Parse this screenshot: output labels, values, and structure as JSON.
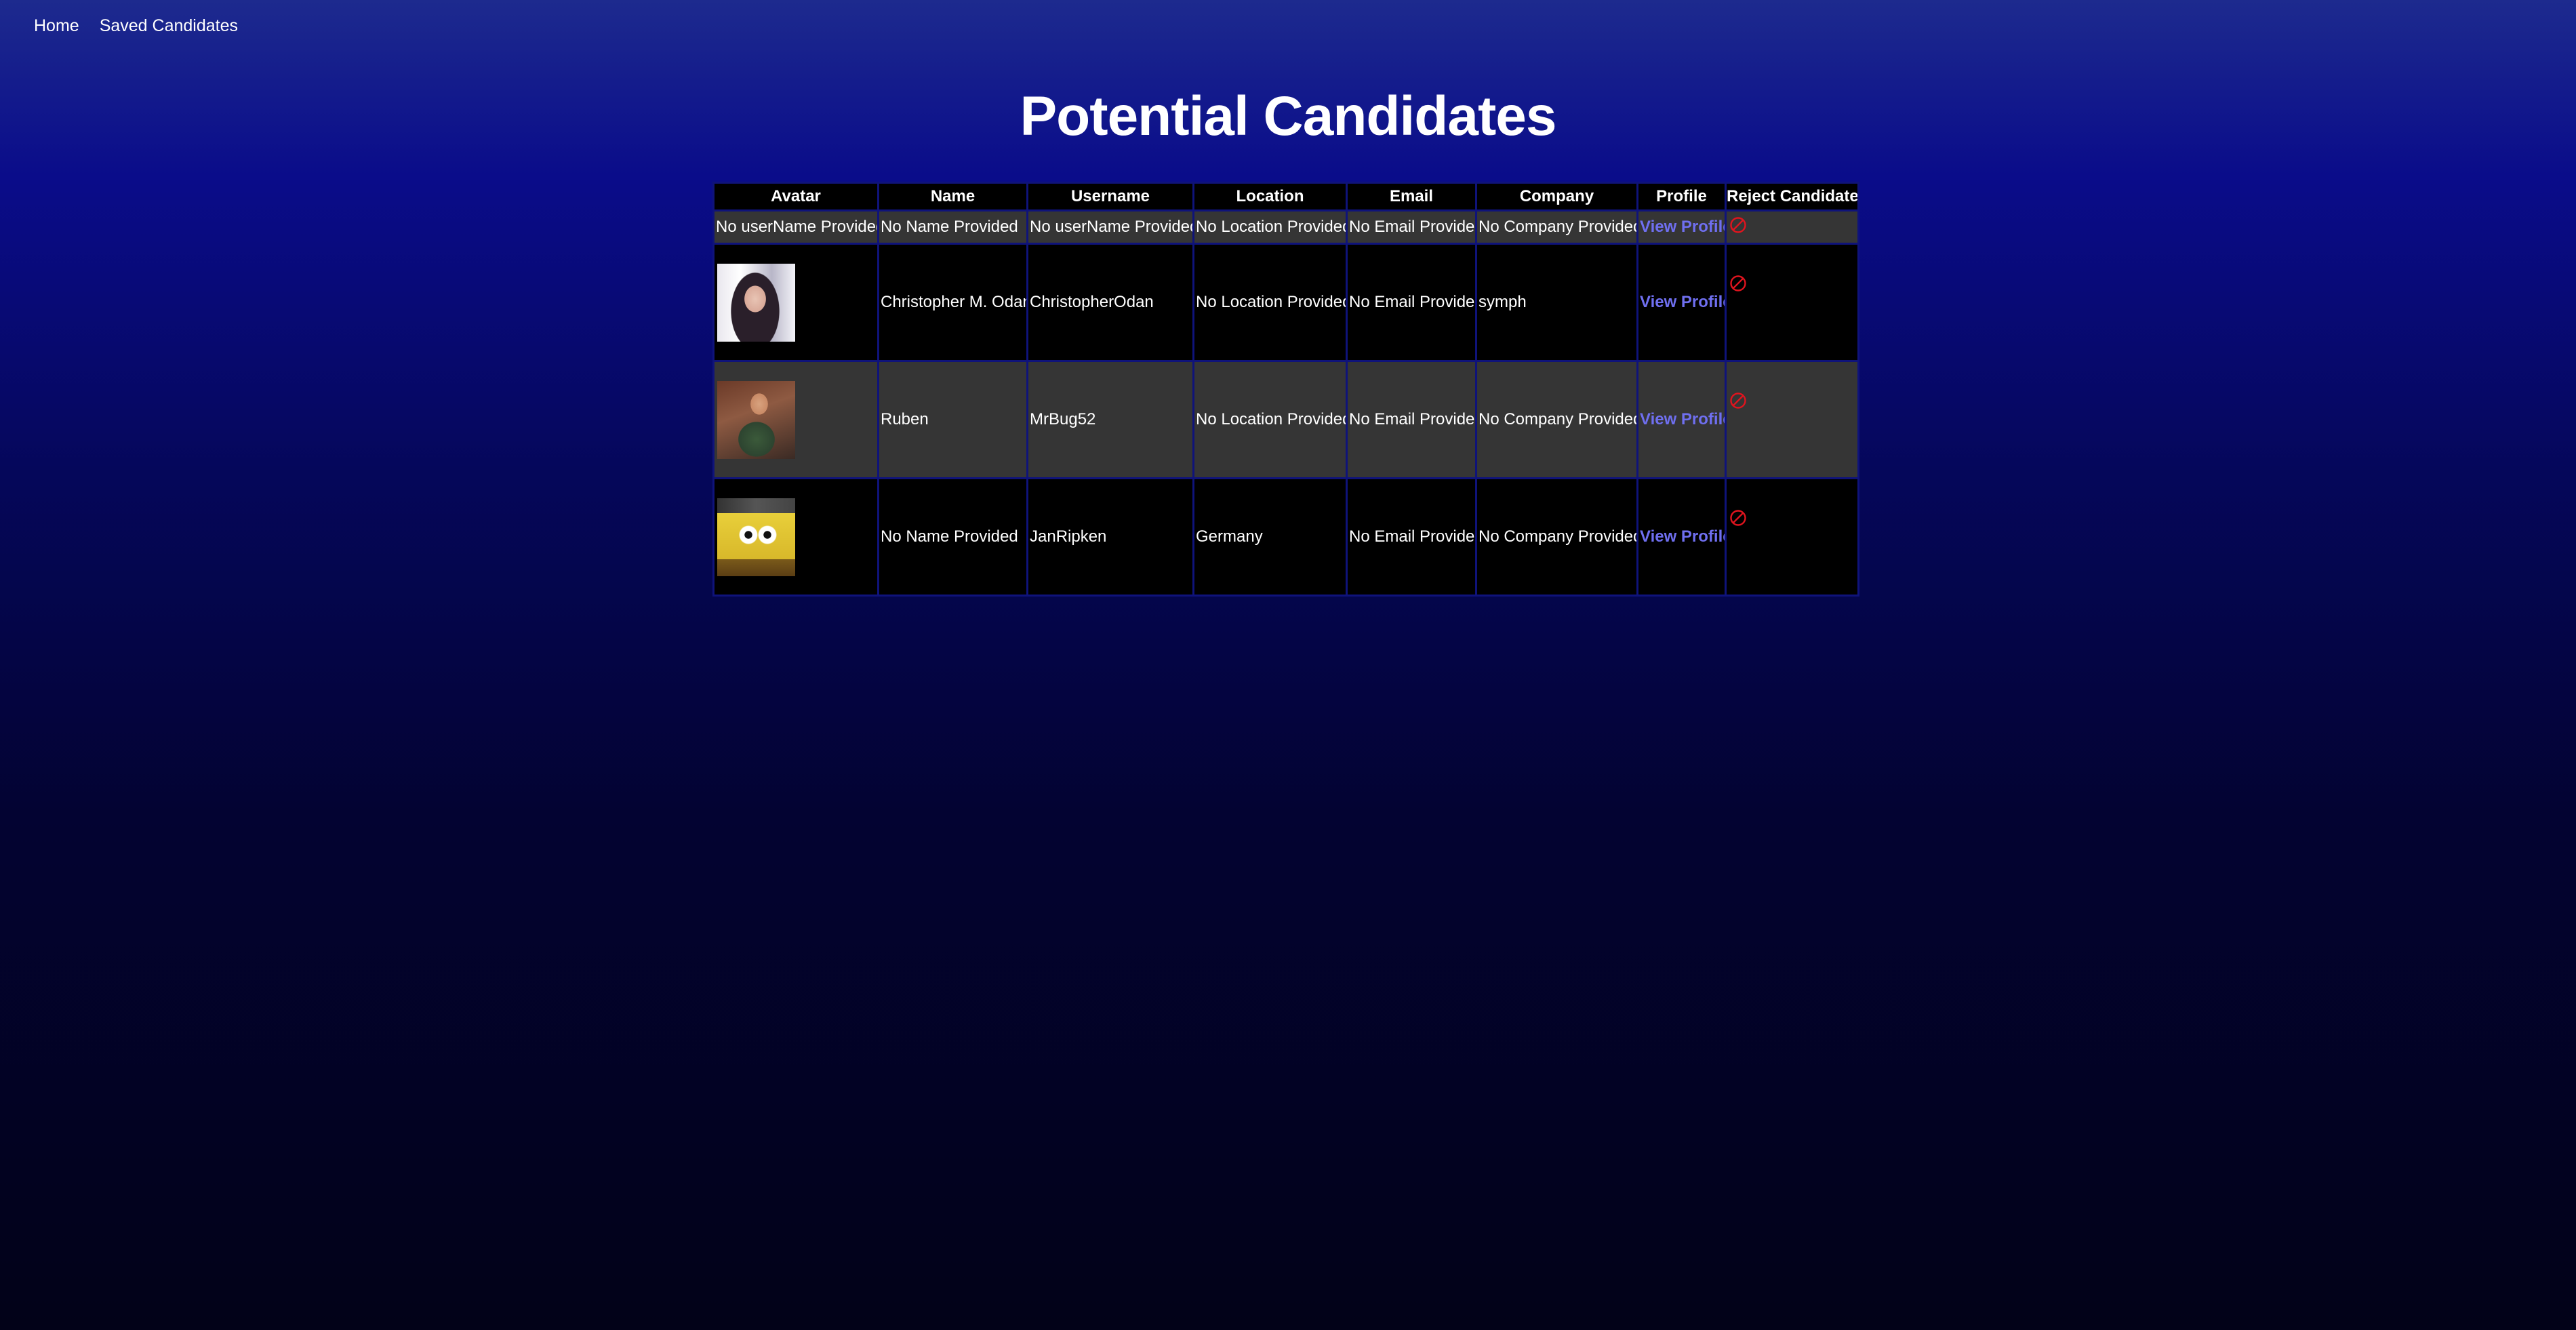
{
  "nav": {
    "home": "Home",
    "saved": "Saved Candidates"
  },
  "page": {
    "title": "Potential Candidates"
  },
  "table": {
    "headers": [
      "Avatar",
      "Name",
      "Username",
      "Location",
      "Email",
      "Company",
      "Profile",
      "Reject Candidate"
    ],
    "rows": [
      {
        "avatar_text": "No userName Provided",
        "name": "No Name Provided",
        "username": "No userName Provided",
        "location": "No Location Provided",
        "email": "No Email Provided",
        "company": "No Company Provided",
        "profile": "View Profile"
      },
      {
        "avatar": "avatar-image",
        "name": "Christopher M. Odan",
        "username": "ChristopherOdan",
        "location": "No Location Provided",
        "email": "No Email Provided",
        "company": "symph",
        "profile": "View Profile"
      },
      {
        "avatar": "avatar-image",
        "name": "Ruben",
        "username": "MrBug52",
        "location": "No Location Provided",
        "email": "No Email Provided",
        "company": "No Company Provided",
        "profile": "View Profile"
      },
      {
        "avatar": "avatar-image",
        "name": "No Name Provided",
        "username": "JanRipken",
        "location": "Germany",
        "email": "No Email Provided",
        "company": "No Company Provided",
        "profile": "View Profile"
      }
    ],
    "reject_icon": "ban-icon"
  },
  "colors": {
    "accent_link": "#6f6ff0",
    "reject": "#e0141e",
    "row_odd": "#353535",
    "row_even": "#000000",
    "table_border": "#0f137a"
  }
}
